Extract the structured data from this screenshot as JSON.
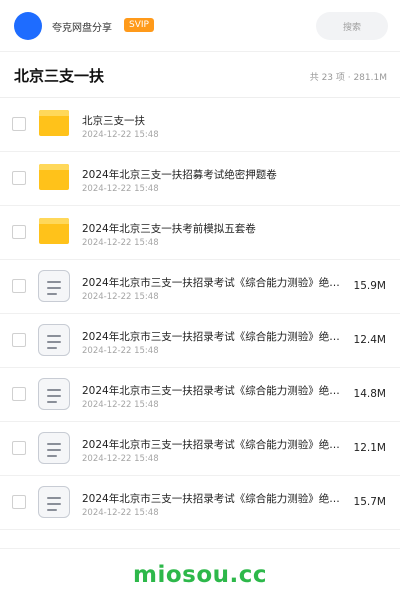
{
  "header": {
    "app_name": "夸克网盘分享",
    "badge": "SVIP",
    "search_placeholder": "搜索",
    "accent_color": "#1e6cff"
  },
  "folder": {
    "title": "北京三支一扶",
    "meta": "共 23 项 · 281.1M"
  },
  "files": [
    {
      "type": "folder-icon",
      "name": "北京三支一扶",
      "date": "2024-12-22 15:48",
      "size": ""
    },
    {
      "type": "folder-icon",
      "name": "2024年北京三支一扶招募考试绝密押题卷",
      "date": "2024-12-22 15:48",
      "size": ""
    },
    {
      "type": "folder-icon",
      "name": "2024年北京三支一扶考前模拟五套卷",
      "date": "2024-12-22 15:48",
      "size": ""
    },
    {
      "type": "document-icon",
      "name": "2024年北京市三支一扶招录考试《综合能力测验》绝…",
      "date": "2024-12-22 15:48",
      "size": "15.9M"
    },
    {
      "type": "document-icon",
      "name": "2024年北京市三支一扶招录考试《综合能力测验》绝…",
      "date": "2024-12-22 15:48",
      "size": "12.4M"
    },
    {
      "type": "document-icon",
      "name": "2024年北京市三支一扶招录考试《综合能力测验》绝…",
      "date": "2024-12-22 15:48",
      "size": "14.8M"
    },
    {
      "type": "document-icon",
      "name": "2024年北京市三支一扶招录考试《综合能力测验》绝…",
      "date": "2024-12-22 15:48",
      "size": "12.1M"
    },
    {
      "type": "document-icon",
      "name": "2024年北京市三支一扶招录考试《综合能力测验》绝…",
      "date": "2024-12-22 15:48",
      "size": "15.7M"
    }
  ],
  "footer": {
    "brand": "miosou.cc",
    "brand_color": "#2db84a"
  }
}
